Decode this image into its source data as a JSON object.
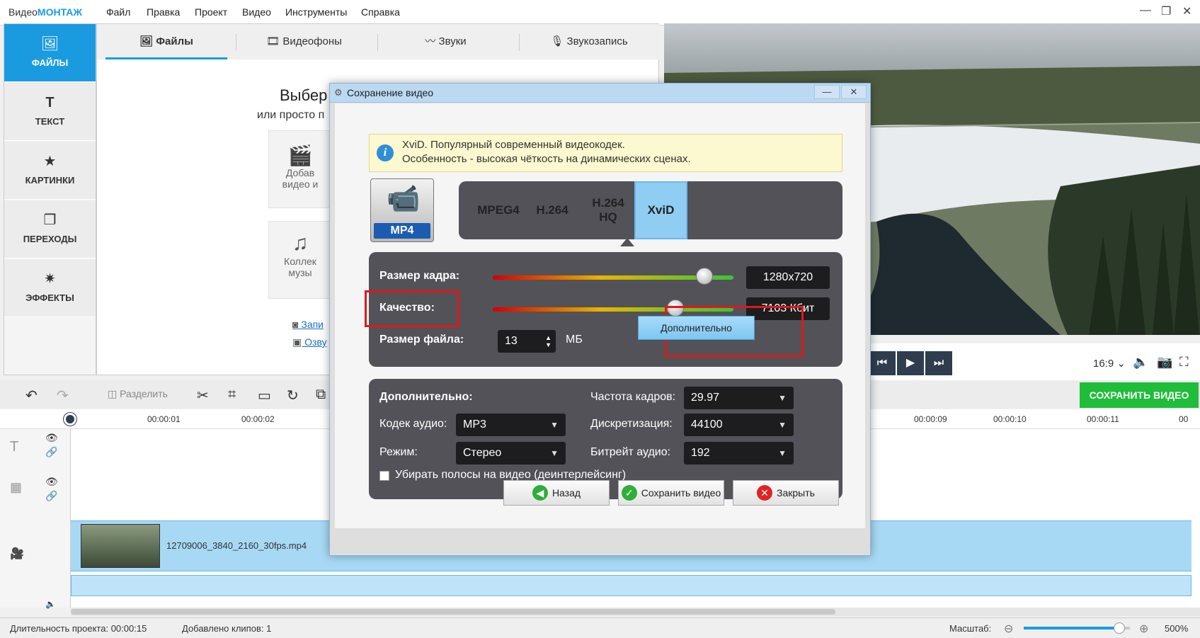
{
  "app": {
    "logo_a": "Видео",
    "logo_b": "МОНТАЖ"
  },
  "menu": [
    "Файл",
    "Правка",
    "Проект",
    "Видео",
    "Инструменты",
    "Справка"
  ],
  "window_controls": {
    "minimize": "—",
    "maximize": "❐",
    "close": "✕"
  },
  "left_nav": [
    {
      "label": "ФАЙЛЫ",
      "icon": "image-icon",
      "glyph": "🖼"
    },
    {
      "label": "ТЕКСТ",
      "icon": "text-icon",
      "glyph": "T"
    },
    {
      "label": "КАРТИНКИ",
      "icon": "star-icon",
      "glyph": "★"
    },
    {
      "label": "ПЕРЕХОДЫ",
      "icon": "transitions-icon",
      "glyph": "❐"
    },
    {
      "label": "ЭФФЕКТЫ",
      "icon": "wand-icon",
      "glyph": "✷"
    }
  ],
  "tabs": [
    {
      "label": "Файлы",
      "glyph": "🖼"
    },
    {
      "label": "Видеофоны",
      "glyph": "🎞"
    },
    {
      "label": "Звуки",
      "glyph": "〰"
    },
    {
      "label": "Звукозапись",
      "glyph": "🎙"
    }
  ],
  "content": {
    "heading_partial": "Выбер",
    "subheading_partial": "или просто п",
    "card1_line1": "Добав",
    "card1_line2": "видео и",
    "card2_line1": "Коллек",
    "card2_line2": "музы",
    "link1": "Запи",
    "link2": "Озву"
  },
  "preview": {
    "aspect": "16:9",
    "aspect_caret": "⌄"
  },
  "save_video_top": "СОХРАНИТЬ ВИДЕО",
  "toolbar": {
    "split": "Разделить"
  },
  "timeline": {
    "ticks": [
      "00:00:01",
      "00:00:02",
      "00:00:09",
      "00:00:10",
      "00:00:11",
      "00"
    ],
    "clip_name": "12709006_3840_2160_30fps.mp4"
  },
  "status": {
    "duration": "Длительность проекта:  00:00:15",
    "clips": "Добавлено клипов: 1",
    "zoom_label": "Масштаб:",
    "zoom_value": "500%",
    "zoom_level": 0.9
  },
  "dialog": {
    "title": "Сохранение видео",
    "info_line1": "XviD. Популярный современный видеокодек.",
    "info_line2": "Особенность - высокая чёткость на динамических сценах.",
    "format": "MP4",
    "codecs": [
      "MPEG4",
      "H.264",
      "H.264 HQ",
      "XviD"
    ],
    "selected_codec": "XviD",
    "frame_size_label": "Размер кадра:",
    "frame_size_value": "1280x720",
    "frame_size_level": 0.88,
    "quality_label": "Качество:",
    "quality_value": "7103 Кбит",
    "quality_level": 0.76,
    "file_size_label": "Размер файла:",
    "file_size_value": "13",
    "file_size_unit": "МБ",
    "advanced_button": "Дополнительно",
    "advanced_title": "Дополнительно:",
    "audio_codec_label": "Кодек аудио:",
    "audio_codec_value": "MP3",
    "mode_label": "Режим:",
    "mode_value": "Стерео",
    "fps_label": "Частота кадров:",
    "fps_value": "29.97",
    "sampling_label": "Дискретизация:",
    "sampling_value": "44100",
    "audio_bitrate_label": "Битрейт аудио:",
    "audio_bitrate_value": "192",
    "deinterlace_label": "Убирать полосы на видео (деинтерлейсинг)",
    "back_button": "Назад",
    "save_button": "Сохранить видео",
    "close_button": "Закрыть"
  }
}
